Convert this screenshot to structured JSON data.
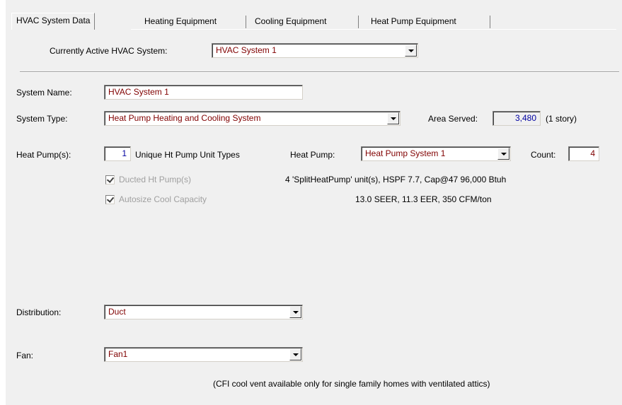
{
  "tabs": [
    {
      "label": "HVAC System Data",
      "active": true
    },
    {
      "label": "Heating Equipment",
      "active": false
    },
    {
      "label": "Cooling Equipment",
      "active": false
    },
    {
      "label": "Heat Pump Equipment",
      "active": false
    }
  ],
  "active_system": {
    "label": "Currently Active HVAC System:",
    "value": "HVAC System 1"
  },
  "system_name": {
    "label": "System Name:",
    "value": "HVAC System 1"
  },
  "system_type": {
    "label": "System Type:",
    "value": "Heat Pump Heating and Cooling System"
  },
  "area_served": {
    "label": "Area Served:",
    "value": "3,480",
    "note": "(1 story)"
  },
  "heat_pumps": {
    "label": "Heat Pump(s):",
    "count_value": "1",
    "unique_label": "Unique Ht Pump Unit Types",
    "heat_pump_label": "Heat Pump:",
    "heat_pump_value": "Heat Pump System 1",
    "count_label": "Count:",
    "unit_count": "4",
    "ducted_label": "Ducted Ht Pump(s)",
    "ducted_checked": true,
    "autosize_label": "Autosize Cool Capacity",
    "autosize_checked": true,
    "summary_line1": "4 'SplitHeatPump' unit(s), HSPF 7.7, Cap@47 96,000 Btuh",
    "summary_line2": "13.0 SEER, 11.3 EER, 350 CFM/ton"
  },
  "distribution": {
    "label": "Distribution:",
    "value": "Duct"
  },
  "fan": {
    "label": "Fan:",
    "value": "Fan1"
  },
  "footnote": "(CFI cool vent available only for single family homes with ventilated attics)",
  "colors": {
    "field_text": "#800000",
    "readonly_text": "#0000a0",
    "dialog_bg": "#f0f0f0"
  }
}
